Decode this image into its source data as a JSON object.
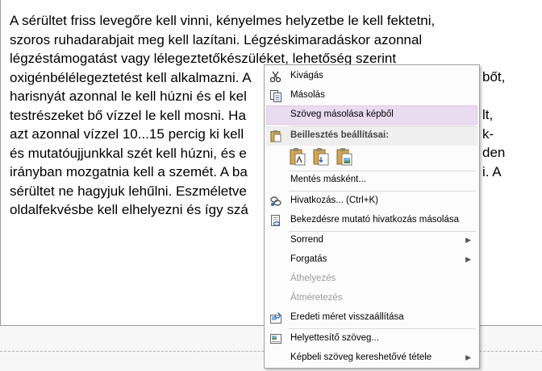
{
  "document": {
    "lines": [
      "A sérültet friss levegőre kell vinni, kényelmes helyzetbe le kell fektetni,",
      "szoros ruhadarabjait meg kell lazítani. Légzéskimaradáskor azonnal",
      "légzéstámogatást vagy lélegeztetőkészüléket, lehetőség szerint",
      "oxigénbélélegeztetést kell alkalmazni. A",
      "harisnyát azonnal le kell húzni és el kel",
      "testrészeket bő vízzel le kell mosni. Ha",
      "azt azonnal vízzel 10...15 percig ki kell",
      "és mutatóujjunkkal szét kell húzni, és e",
      "irányban mozgatnia kell a szemét. A ba",
      "sérültet ne hagyjuk lehűlni. Eszméletve",
      "oldalfekvésbe kell elhelyezni és így szá"
    ],
    "right_fragments": [
      "bőt,",
      "lt,",
      "k-",
      "den",
      "i. A"
    ]
  },
  "context_menu": {
    "cut": "Kivágás",
    "copy": "Másolás",
    "copy_text_from_picture": "Szöveg másolása képből",
    "paste_options_header": "Beillesztés beállításai:",
    "save_as_picture": "Mentés másként...",
    "link": "Hivatkozás...  (Ctrl+K)",
    "copy_link_to_paragraph": "Bekezdésre mutató hivatkozás másolása",
    "order": "Sorrend",
    "rotate": "Forgatás",
    "move": "Áthelyezés",
    "resize": "Átméretezés",
    "restore_original_size": "Eredeti méret visszaállítása",
    "alt_text": "Helyettesítő szöveg...",
    "make_text_searchable": "Képbeli szöveg kereshetővé tétele"
  }
}
